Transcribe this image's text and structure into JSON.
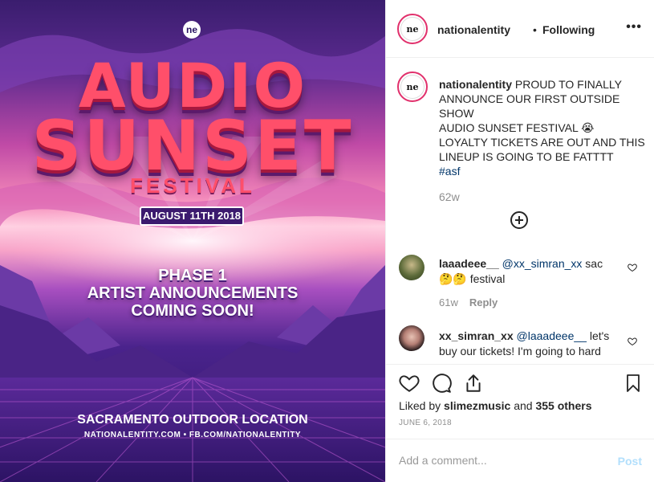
{
  "poster": {
    "logo": "ne",
    "title_line1": "AUDIO",
    "title_line2": "SUNSET",
    "subtitle": "FESTIVAL",
    "date": "AUGUST 11TH 2018",
    "phase_lines": [
      "PHASE 1",
      "ARTIST ANNOUNCEMENTS",
      "COMING SOON!"
    ],
    "location": "SACRAMENTO OUTDOOR LOCATION",
    "urls": "NATIONALENTITY.COM • FB.COM/NATIONALENTITY"
  },
  "header": {
    "username": "nationalentity",
    "separator": "•",
    "follow_status": "Following",
    "more": "•••",
    "avatar_text": "ne"
  },
  "caption": {
    "username": "nationalentity",
    "text": "PROUD TO FINALLY ANNOUNCE OUR FIRST OUTSIDE SHOW",
    "line2": "AUDIO SUNSET FESTIVAL 😭",
    "line3": "LOYALTY TICKETS ARE OUT AND THIS LINEUP IS GOING TO BE FATTTT",
    "hashtag": "#asf",
    "age": "62w"
  },
  "comments": [
    {
      "username": "laaadeee__",
      "mention": "@xx_simran_xx",
      "text": " sac🤔🤔 festival",
      "age": "61w",
      "reply": "Reply"
    },
    {
      "username": "xx_simran_xx",
      "mention": "@laaadeee__",
      "text": " let's buy our tickets! I'm going to hard",
      "age": "",
      "reply": ""
    }
  ],
  "likes": {
    "prefix": "Liked by ",
    "user": "slimezmusic",
    "middle": " and ",
    "others": "355 others"
  },
  "date": "JUNE 6, 2018",
  "add_comment": {
    "placeholder": "Add a comment...",
    "post_label": "Post"
  },
  "colors": {
    "link": "#003569",
    "muted": "#8e8e8e",
    "post_disabled": "#b2dffc",
    "story_ring": "#e1306c"
  },
  "icons": [
    "heart-icon",
    "comment-icon",
    "share-icon",
    "bookmark-icon",
    "plus-circle-icon",
    "more-icon"
  ]
}
